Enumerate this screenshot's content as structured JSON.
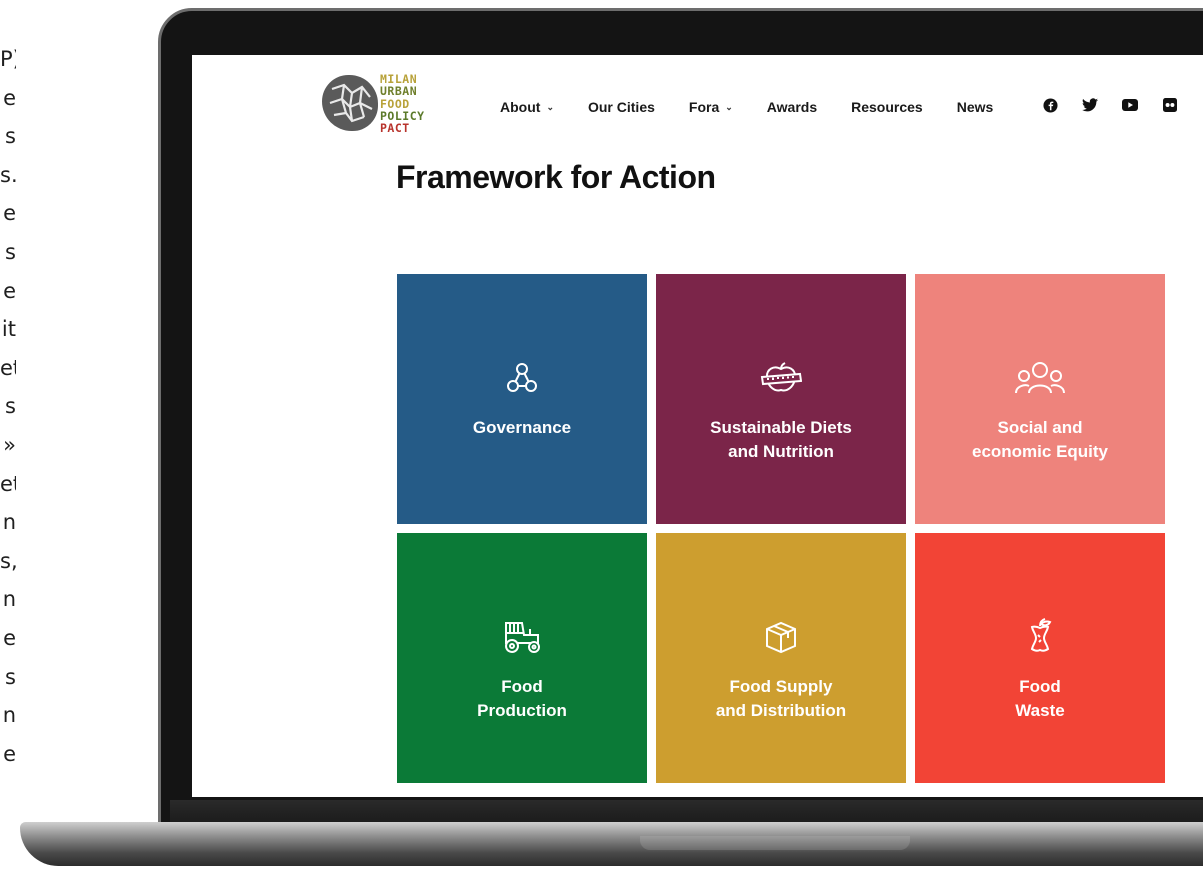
{
  "side_text": [
    "P)",
    "e",
    "s",
    "s.",
    "e",
    "s",
    "e",
    "it",
    "et",
    "s",
    "»",
    "et",
    "n",
    "s,",
    "n",
    "e",
    "s",
    "n",
    "e"
  ],
  "logo": {
    "lines": [
      "MILAN",
      "URBAN",
      "FOOD",
      "POLICY",
      "PACT"
    ],
    "colors": [
      "#b8a23a",
      "#6f7f2c",
      "#b8a23a",
      "#5b7a2a",
      "#b8332c"
    ]
  },
  "nav": [
    {
      "label": "About",
      "dropdown": true
    },
    {
      "label": "Our Cities",
      "dropdown": false
    },
    {
      "label": "Fora",
      "dropdown": true
    },
    {
      "label": "Awards",
      "dropdown": false
    },
    {
      "label": "Resources",
      "dropdown": false
    },
    {
      "label": "News",
      "dropdown": false
    }
  ],
  "socials": [
    "facebook-icon",
    "twitter-icon",
    "youtube-icon",
    "flickr-icon"
  ],
  "page_title": "Framework for Action",
  "tiles": [
    {
      "label": "Governance",
      "color": "#255b87",
      "icon": "network-icon"
    },
    {
      "label": "Sustainable Diets\nand Nutrition",
      "color": "#7b2549",
      "icon": "apple-measure-icon"
    },
    {
      "label": "Social and\neconomic Equity",
      "color": "#ee837c",
      "icon": "people-icon"
    },
    {
      "label": "Food\nProduction",
      "color": "#0b7a37",
      "icon": "tractor-icon"
    },
    {
      "label": "Food Supply\nand Distribution",
      "color": "#cd9e2f",
      "icon": "box-icon"
    },
    {
      "label": "Food\nWaste",
      "color": "#f24436",
      "icon": "apple-core-icon"
    }
  ]
}
